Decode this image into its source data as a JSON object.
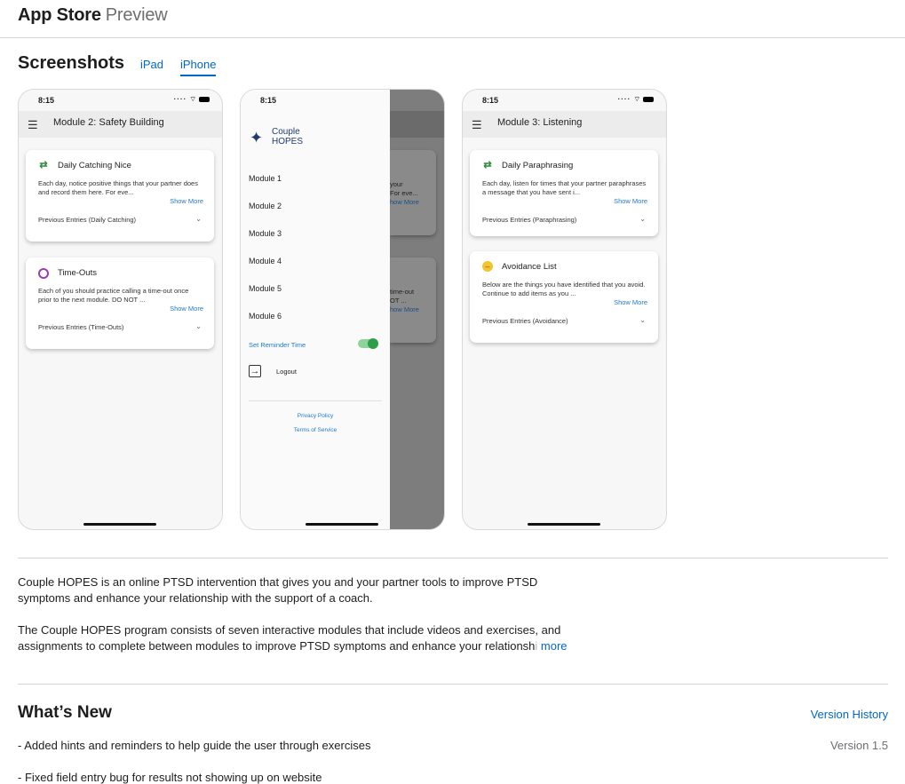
{
  "header": {
    "brand": "App Store",
    "subtitle": "Preview"
  },
  "screenshots": {
    "title": "Screenshots",
    "tabs": [
      {
        "label": "iPad"
      },
      {
        "label": "iPhone",
        "selected": true
      }
    ],
    "phones": [
      {
        "time": "8:15",
        "title": "Module 2: Safety Building",
        "cards": [
          {
            "title": "Daily Catching Nice",
            "icon": "repeat-icon",
            "desc": "Each day, notice positive things that your partner does and record them here. For eve...",
            "more": "Show More",
            "prev": "Previous Entries (Daily Catching)"
          },
          {
            "title": "Time-Outs",
            "icon": "timeout-icon",
            "desc": "Each of you should practice calling a time-out once prior to the next module. DO NOT ...",
            "more": "Show More",
            "prev": "Previous Entries (Time-Outs)"
          }
        ]
      },
      {
        "time": "8:15",
        "logo_line1": "Couple",
        "logo_line2": "HOPES",
        "modules": [
          "Module 1",
          "Module 2",
          "Module 3",
          "Module 4",
          "Module 5",
          "Module 6"
        ],
        "reminder": "Set Reminder Time",
        "reminder_on": true,
        "logout": "Logout",
        "privacy": "Privacy Policy",
        "terms": "Terms of Service",
        "peek": {
          "a1": "your",
          "a2": "For eve...",
          "a3": "how More",
          "b1": "time-out",
          "b2": "OT ...",
          "b3": "how More"
        }
      },
      {
        "time": "8:15",
        "title": "Module 3: Listening",
        "cards": [
          {
            "title": "Daily Paraphrasing",
            "icon": "repeat-icon",
            "desc": "Each day, listen for times that your partner paraphrases a message that you have sent i...",
            "more": "Show More",
            "prev": "Previous Entries (Paraphrasing)"
          },
          {
            "title": "Avoidance List",
            "icon": "avoidance-icon",
            "desc": "Below are the things you have identified that you avoid. Continue to add items as you ...",
            "more": "Show More",
            "prev": "Previous Entries (Avoidance)"
          }
        ]
      }
    ]
  },
  "description": {
    "p1": "Couple HOPES is an online PTSD intervention that gives you and your partner tools to improve PTSD symptoms and enhance your relationship with the support of a coach.",
    "p2_visible": "The Couple HOPES program consists of seven interactive modules that include videos and exercises, and assignments to complete between modules to improve PTSD symptoms and enhance your relationsh",
    "p2_faded": "i",
    "more": "more"
  },
  "whats_new": {
    "title": "What’s New",
    "version_history": "Version History",
    "version": "Version 1.5",
    "notes": [
      "- Added hints and reminders to help guide the user through exercises",
      "- Fixed field entry bug for results not showing up on website"
    ]
  },
  "colors": {
    "link": "#0066cc",
    "accent_green": "#2e9e4a",
    "divider": "#d2d2d7"
  }
}
